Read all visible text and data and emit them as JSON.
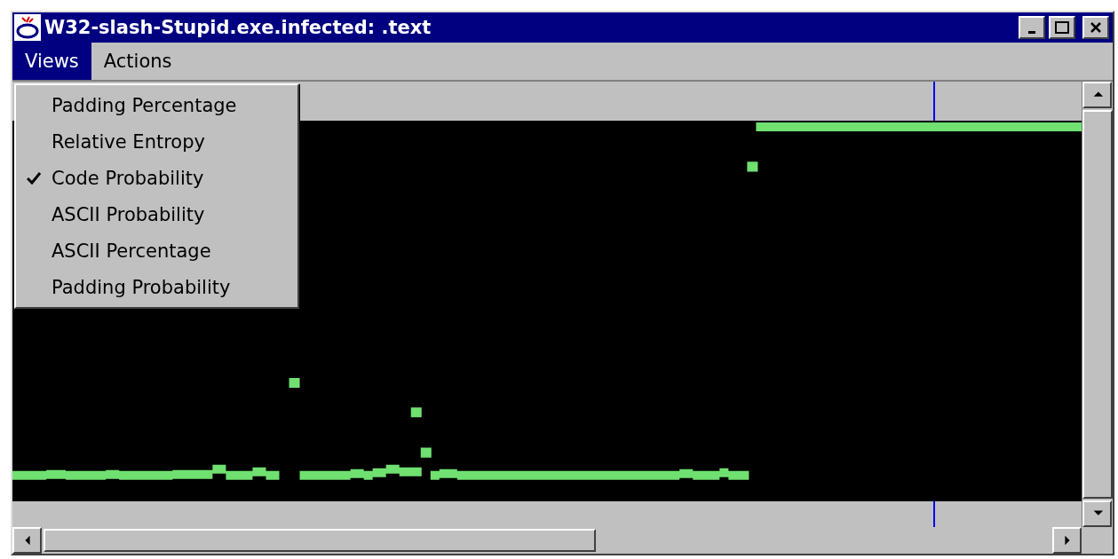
{
  "window": {
    "title": "W32-slash-Stupid.exe.infected: .text"
  },
  "menu_bar": [
    {
      "label": "Views",
      "selected": true
    },
    {
      "label": "Actions",
      "selected": false
    }
  ],
  "views_menu": [
    {
      "label": "Padding Percentage",
      "checked": false
    },
    {
      "label": "Relative Entropy",
      "checked": false
    },
    {
      "label": "Code Probability",
      "checked": true
    },
    {
      "label": "ASCII Probability",
      "checked": false
    },
    {
      "label": "ASCII Percentage",
      "checked": false
    },
    {
      "label": "Padding Probability",
      "checked": false
    }
  ]
}
